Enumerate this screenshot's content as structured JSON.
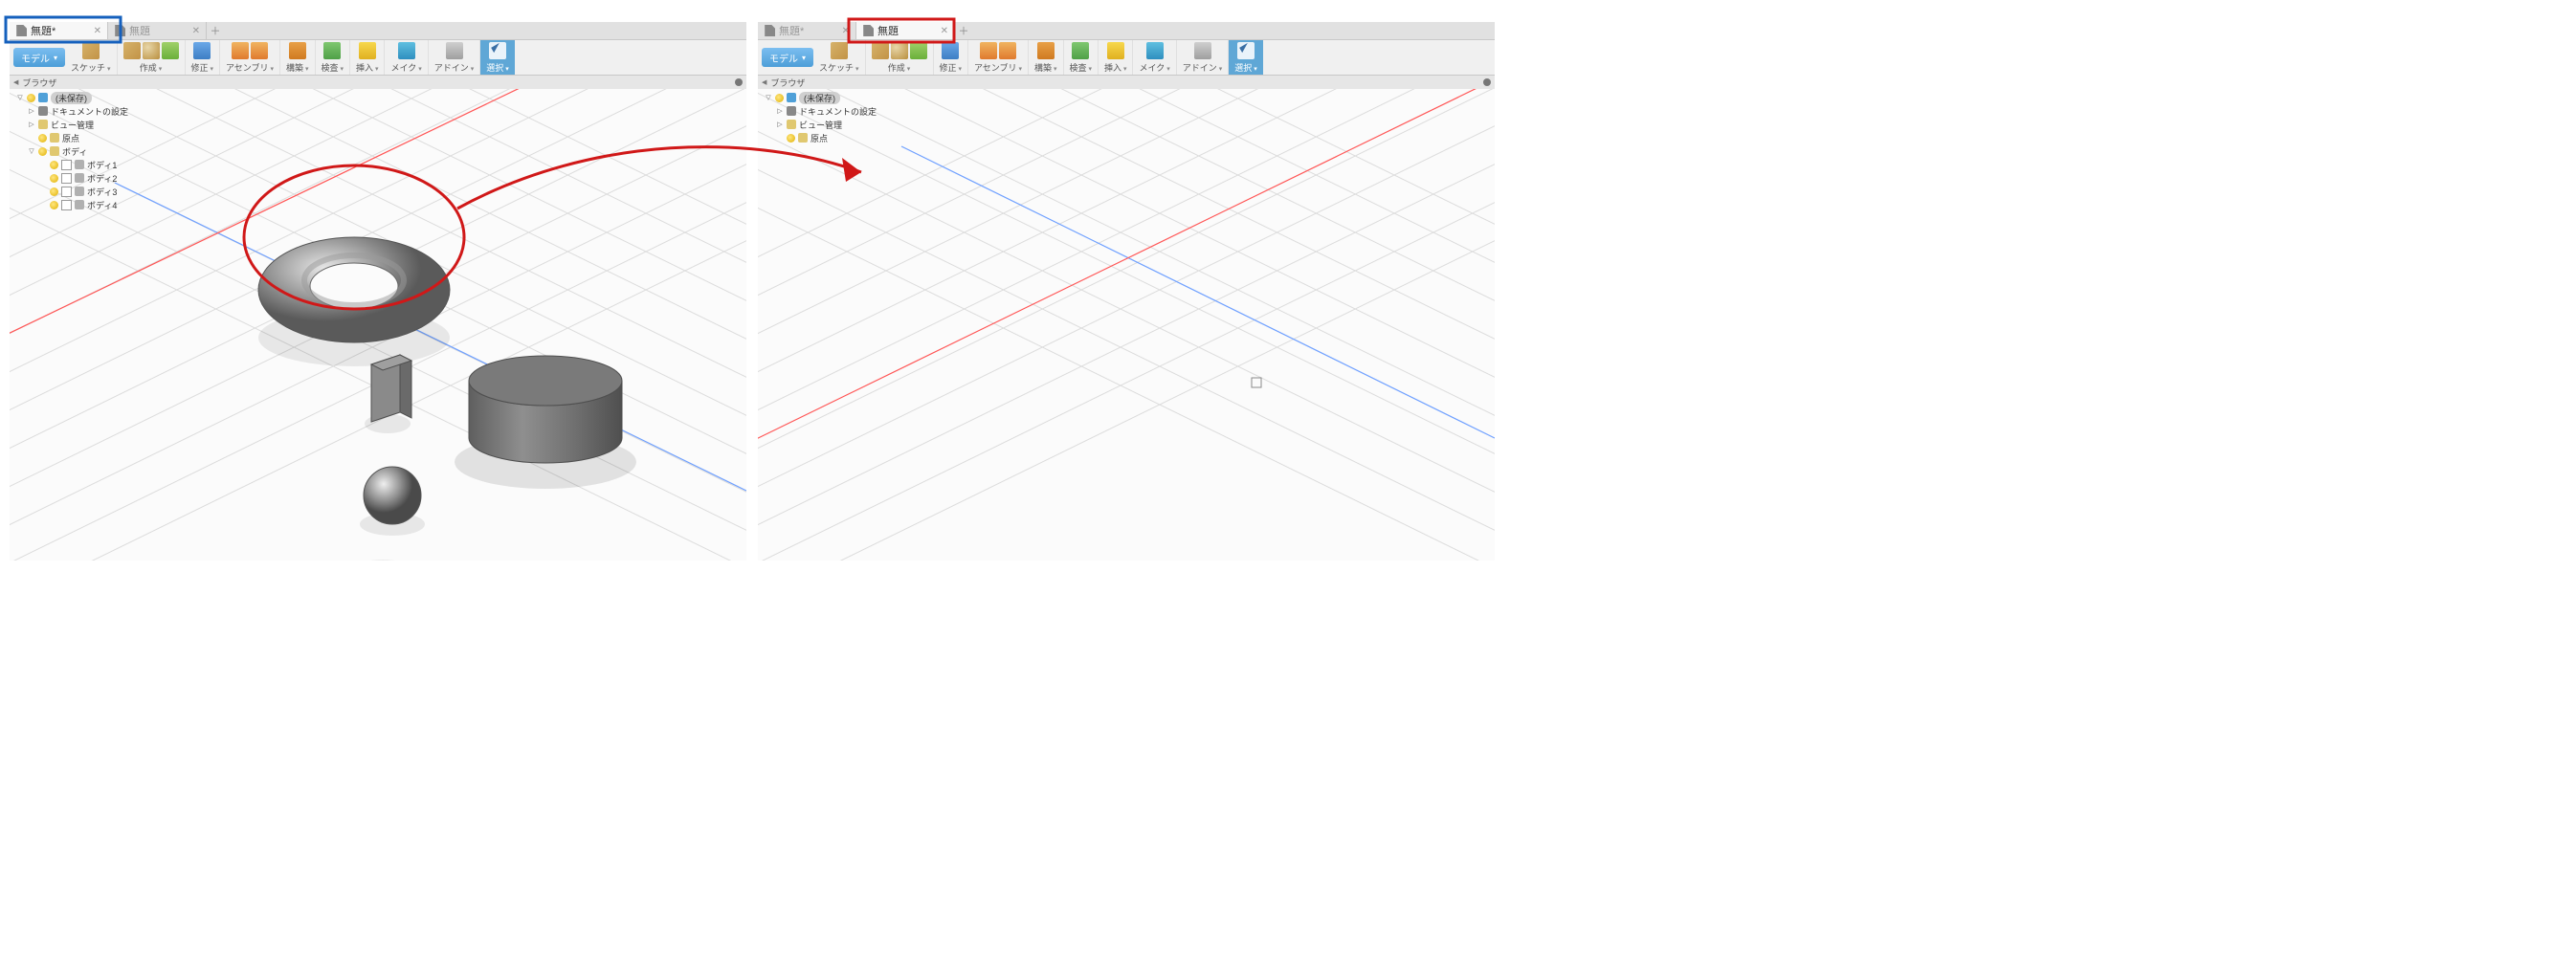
{
  "left": {
    "tabs": [
      {
        "label": "無題*",
        "active": true
      },
      {
        "label": "無題",
        "active": false
      }
    ],
    "workspace_label": "モデル",
    "toolbar_groups": [
      {
        "label": "スケッチ",
        "sel": false,
        "icons": [
          "box"
        ]
      },
      {
        "label": "作成",
        "sel": false,
        "icons": [
          "box",
          "sphere",
          "ext"
        ]
      },
      {
        "label": "修正",
        "sel": false,
        "icons": [
          "edit"
        ]
      },
      {
        "label": "アセンブリ",
        "sel": false,
        "icons": [
          "asm",
          "asm"
        ]
      },
      {
        "label": "構築",
        "sel": false,
        "icons": [
          "plane"
        ]
      },
      {
        "label": "検査",
        "sel": false,
        "icons": [
          "wave"
        ]
      },
      {
        "label": "挿入",
        "sel": false,
        "icons": [
          "mes"
        ]
      },
      {
        "label": "メイク",
        "sel": false,
        "icons": [
          "make"
        ]
      },
      {
        "label": "アドイン",
        "sel": false,
        "icons": [
          "add"
        ]
      },
      {
        "label": "選択",
        "sel": true,
        "icons": [
          "sel"
        ]
      }
    ],
    "browser_title": "ブラウザ",
    "tree": [
      {
        "depth": 0,
        "tri": "open",
        "bulb": "on",
        "root": true,
        "label": "(未保存)",
        "ico": "comp"
      },
      {
        "depth": 1,
        "tri": "closed",
        "ico": "gear",
        "label": "ドキュメントの設定"
      },
      {
        "depth": 1,
        "tri": "closed",
        "ico": "fold",
        "label": "ビュー管理"
      },
      {
        "depth": 1,
        "tri": "none",
        "bulb": "on",
        "ico": "fold",
        "label": "原点"
      },
      {
        "depth": 1,
        "tri": "open",
        "bulb": "on",
        "ico": "fold",
        "label": "ボディ"
      },
      {
        "depth": 2,
        "tri": "none",
        "bulb": "on",
        "ck": true,
        "ico": "cube",
        "label": "ボディ1"
      },
      {
        "depth": 2,
        "tri": "none",
        "bulb": "on",
        "ck": true,
        "ico": "cube",
        "label": "ボディ2"
      },
      {
        "depth": 2,
        "tri": "none",
        "bulb": "on",
        "ck": true,
        "ico": "cube",
        "label": "ボディ3"
      },
      {
        "depth": 2,
        "tri": "none",
        "bulb": "on",
        "ck": true,
        "ico": "cube",
        "label": "ボディ4"
      }
    ]
  },
  "right": {
    "tabs": [
      {
        "label": "無題*",
        "active": false
      },
      {
        "label": "無題",
        "active": true
      }
    ],
    "workspace_label": "モデル",
    "toolbar_groups": [
      {
        "label": "スケッチ",
        "sel": false,
        "icons": [
          "box"
        ]
      },
      {
        "label": "作成",
        "sel": false,
        "icons": [
          "box",
          "sphere",
          "ext"
        ]
      },
      {
        "label": "修正",
        "sel": false,
        "icons": [
          "edit"
        ]
      },
      {
        "label": "アセンブリ",
        "sel": false,
        "icons": [
          "asm",
          "asm"
        ]
      },
      {
        "label": "構築",
        "sel": false,
        "icons": [
          "plane"
        ]
      },
      {
        "label": "検査",
        "sel": false,
        "icons": [
          "wave"
        ]
      },
      {
        "label": "挿入",
        "sel": false,
        "icons": [
          "mes"
        ]
      },
      {
        "label": "メイク",
        "sel": false,
        "icons": [
          "make"
        ]
      },
      {
        "label": "アドイン",
        "sel": false,
        "icons": [
          "add"
        ]
      },
      {
        "label": "選択",
        "sel": true,
        "icons": [
          "sel"
        ]
      }
    ],
    "browser_title": "ブラウザ",
    "tree": [
      {
        "depth": 0,
        "tri": "open",
        "bulb": "on",
        "root": true,
        "label": "(未保存)",
        "ico": "comp"
      },
      {
        "depth": 1,
        "tri": "closed",
        "ico": "gear",
        "label": "ドキュメントの設定"
      },
      {
        "depth": 1,
        "tri": "closed",
        "ico": "fold",
        "label": "ビュー管理"
      },
      {
        "depth": 1,
        "tri": "none",
        "bulb": "on",
        "ico": "fold",
        "label": "原点"
      }
    ]
  },
  "annotation": {
    "blue_box_desc": "blue rectangle around left-window active tab",
    "red_box_desc": "red rectangle around right-window active tab",
    "red_circle_desc": "red ellipse around torus body in left canvas",
    "red_arrow_desc": "red arrow from torus to right canvas"
  }
}
